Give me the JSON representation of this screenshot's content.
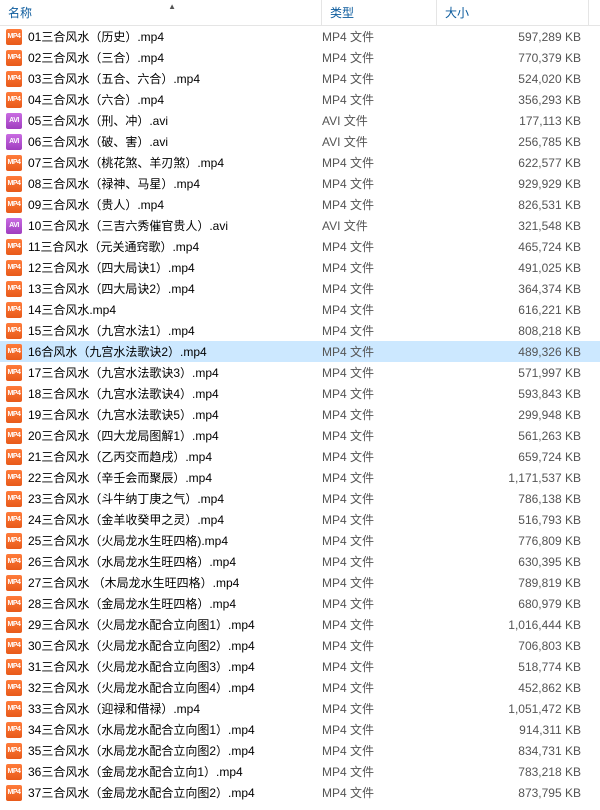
{
  "columns": {
    "name": "名称",
    "type": "类型",
    "size": "大小"
  },
  "selected_index": 15,
  "files": [
    {
      "name": "01三合风水（历史）.mp4",
      "type": "MP4 文件",
      "size": "597,289 KB",
      "ext": "mp4"
    },
    {
      "name": "02三合风水（三合）.mp4",
      "type": "MP4 文件",
      "size": "770,379 KB",
      "ext": "mp4"
    },
    {
      "name": "03三合风水（五合、六合）.mp4",
      "type": "MP4 文件",
      "size": "524,020 KB",
      "ext": "mp4"
    },
    {
      "name": "04三合风水（六合）.mp4",
      "type": "MP4 文件",
      "size": "356,293 KB",
      "ext": "mp4"
    },
    {
      "name": "05三合风水（刑、冲）.avi",
      "type": "AVI 文件",
      "size": "177,113 KB",
      "ext": "avi"
    },
    {
      "name": "06三合风水（破、害）.avi",
      "type": "AVI 文件",
      "size": "256,785 KB",
      "ext": "avi"
    },
    {
      "name": "07三合风水（桃花煞、羊刃煞）.mp4",
      "type": "MP4 文件",
      "size": "622,577 KB",
      "ext": "mp4"
    },
    {
      "name": "08三合风水（禄神、马星）.mp4",
      "type": "MP4 文件",
      "size": "929,929 KB",
      "ext": "mp4"
    },
    {
      "name": "09三合风水（贵人）.mp4",
      "type": "MP4 文件",
      "size": "826,531 KB",
      "ext": "mp4"
    },
    {
      "name": "10三合风水（三吉六秀催官贵人）.avi",
      "type": "AVI 文件",
      "size": "321,548 KB",
      "ext": "avi"
    },
    {
      "name": "11三合风水（元关通窍歌）.mp4",
      "type": "MP4 文件",
      "size": "465,724 KB",
      "ext": "mp4"
    },
    {
      "name": "12三合风水（四大局诀1）.mp4",
      "type": "MP4 文件",
      "size": "491,025 KB",
      "ext": "mp4"
    },
    {
      "name": "13三合风水（四大局诀2）.mp4",
      "type": "MP4 文件",
      "size": "364,374 KB",
      "ext": "mp4"
    },
    {
      "name": "14三合风水.mp4",
      "type": "MP4 文件",
      "size": "616,221 KB",
      "ext": "mp4"
    },
    {
      "name": "15三合风水（九宫水法1）.mp4",
      "type": "MP4 文件",
      "size": "808,218 KB",
      "ext": "mp4"
    },
    {
      "name": "16合风水（九宫水法歌诀2）.mp4",
      "type": "MP4 文件",
      "size": "489,326 KB",
      "ext": "mp4"
    },
    {
      "name": "17三合风水（九宫水法歌诀3）.mp4",
      "type": "MP4 文件",
      "size": "571,997 KB",
      "ext": "mp4"
    },
    {
      "name": "18三合风水（九宫水法歌诀4）.mp4",
      "type": "MP4 文件",
      "size": "593,843 KB",
      "ext": "mp4"
    },
    {
      "name": "19三合风水（九宫水法歌诀5）.mp4",
      "type": "MP4 文件",
      "size": "299,948 KB",
      "ext": "mp4"
    },
    {
      "name": "20三合风水（四大龙局图解1）.mp4",
      "type": "MP4 文件",
      "size": "561,263 KB",
      "ext": "mp4"
    },
    {
      "name": "21三合风水（乙丙交而趋戌）.mp4",
      "type": "MP4 文件",
      "size": "659,724 KB",
      "ext": "mp4"
    },
    {
      "name": "22三合风水（辛壬会而聚辰）.mp4",
      "type": "MP4 文件",
      "size": "1,171,537 KB",
      "ext": "mp4"
    },
    {
      "name": "23三合风水（斗牛纳丁庚之气）.mp4",
      "type": "MP4 文件",
      "size": "786,138 KB",
      "ext": "mp4"
    },
    {
      "name": "24三合风水（金羊收癸甲之灵）.mp4",
      "type": "MP4 文件",
      "size": "516,793 KB",
      "ext": "mp4"
    },
    {
      "name": "25三合风水（火局龙水生旺四格).mp4",
      "type": "MP4 文件",
      "size": "776,809 KB",
      "ext": "mp4"
    },
    {
      "name": "26三合风水（水局龙水生旺四格）.mp4",
      "type": "MP4 文件",
      "size": "630,395 KB",
      "ext": "mp4"
    },
    {
      "name": "27三合风水 （木局龙水生旺四格）.mp4",
      "type": "MP4 文件",
      "size": "789,819 KB",
      "ext": "mp4"
    },
    {
      "name": "28三合风水（金局龙水生旺四格）.mp4",
      "type": "MP4 文件",
      "size": "680,979 KB",
      "ext": "mp4"
    },
    {
      "name": "29三合风水（火局龙水配合立向图1）.mp4",
      "type": "MP4 文件",
      "size": "1,016,444 KB",
      "ext": "mp4"
    },
    {
      "name": "30三合风水（火局龙水配合立向图2）.mp4",
      "type": "MP4 文件",
      "size": "706,803 KB",
      "ext": "mp4"
    },
    {
      "name": "31三合风水（火局龙水配合立向图3）.mp4",
      "type": "MP4 文件",
      "size": "518,774 KB",
      "ext": "mp4"
    },
    {
      "name": "32三合风水（火局龙水配合立向图4）.mp4",
      "type": "MP4 文件",
      "size": "452,862 KB",
      "ext": "mp4"
    },
    {
      "name": "33三合风水（迎禄和借禄）.mp4",
      "type": "MP4 文件",
      "size": "1,051,472 KB",
      "ext": "mp4"
    },
    {
      "name": "34三合风水（水局龙水配合立向图1）.mp4",
      "type": "MP4 文件",
      "size": "914,311 KB",
      "ext": "mp4"
    },
    {
      "name": "35三合风水（水局龙水配合立向图2）.mp4",
      "type": "MP4 文件",
      "size": "834,731 KB",
      "ext": "mp4"
    },
    {
      "name": "36三合风水（金局龙水配合立向1）.mp4",
      "type": "MP4 文件",
      "size": "783,218 KB",
      "ext": "mp4"
    },
    {
      "name": "37三合风水（金局龙水配合立向图2）.mp4",
      "type": "MP4 文件",
      "size": "873,795 KB",
      "ext": "mp4"
    }
  ]
}
